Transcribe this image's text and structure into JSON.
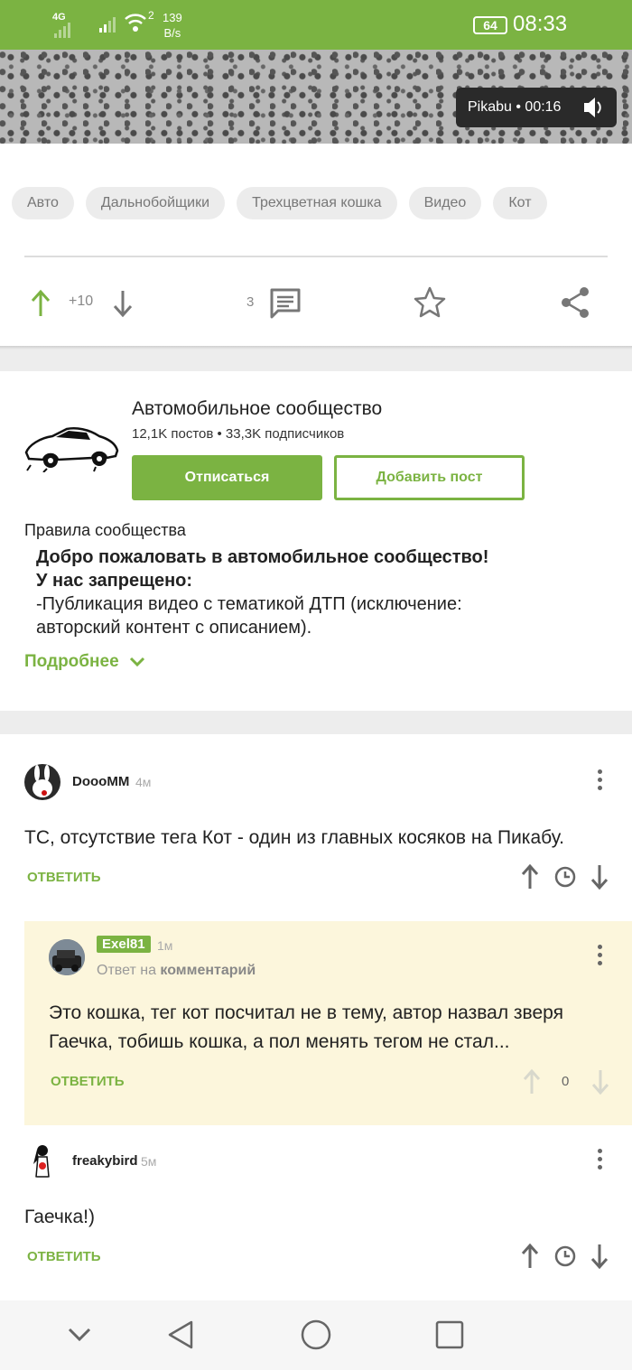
{
  "status_bar": {
    "network": "4G",
    "wifi_badge": "2",
    "speed_value": "139",
    "speed_unit": "B/s",
    "battery": "64",
    "time": "08:33"
  },
  "video": {
    "badge": "Pikabu • 00:16",
    "volume_icon": "volume-icon"
  },
  "tags": [
    "Авто",
    "Дальнобойщики",
    "Трехцветная кошка",
    "Видео",
    "Кот"
  ],
  "post_actions": {
    "rating": "+10",
    "comments_count": "3"
  },
  "community": {
    "title": "Автомобильное сообщество",
    "stats": "12,1K постов • 33,3K подписчиков",
    "unsubscribe_label": "Отписаться",
    "add_post_label": "Добавить пост",
    "rules_heading": "Правила сообщества",
    "rules_bold_1": "Добро пожаловать в автомобильное сообщество!",
    "rules_bold_2": "У нас запрещено:",
    "rules_line_1": "-Публикация видео с тематикой ДТП (исключение:",
    "rules_line_2": "авторский контент с описанием).",
    "more_label": "Подробнее"
  },
  "comments": [
    {
      "user": "DoooMM",
      "time": "4м",
      "text": "ТС, отсутствие тега Кот - один из главных косяков на Пикабу.",
      "reply_label": "ОТВЕТИТЬ"
    },
    {
      "user": "Exel81",
      "time": "1м",
      "reply_to_prefix": "Ответ на",
      "reply_to_link": "комментарий",
      "text_line_1": "Это кошка, тег кот посчитал не в тему, автор назвал зверя",
      "text_line_2": "Гаечка, тобишь кошка, а пол менять тегом не стал...",
      "reply_label": "ОТВЕТИТЬ",
      "rating": "0"
    },
    {
      "user": "freakybird",
      "time": "5м",
      "text": "Гаечка!)",
      "reply_label": "ОТВЕТИТЬ"
    }
  ],
  "colors": {
    "brand": "#7bb342",
    "reply_bg": "#fcf6dc"
  }
}
